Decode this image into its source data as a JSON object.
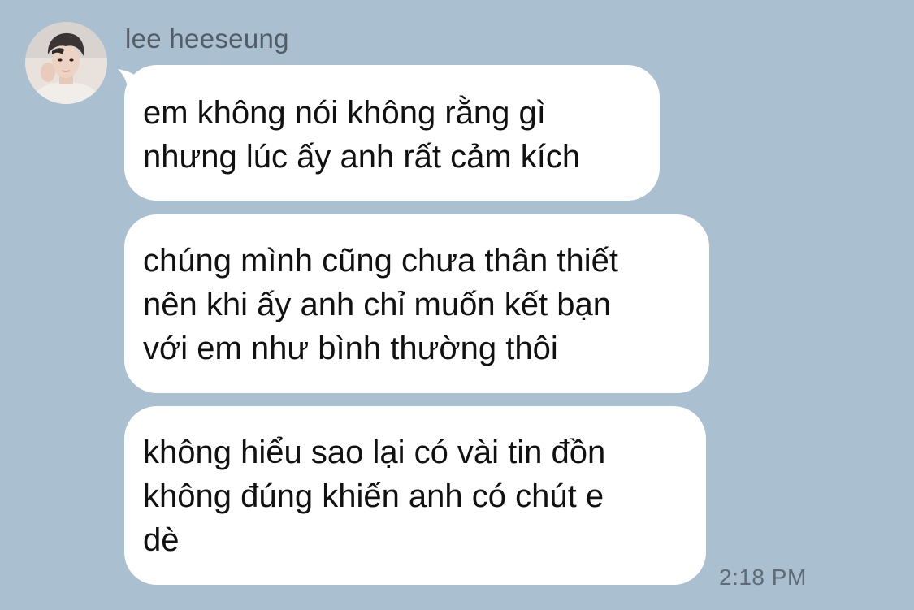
{
  "sender": {
    "name": "lee heeseung",
    "avatar_icon": "profile-photo"
  },
  "messages": [
    {
      "lines": [
        "em không nói không rằng gì",
        "nhưng lúc ấy anh rất cảm kích"
      ]
    },
    {
      "lines": [
        "chúng mình cũng chưa thân thiết",
        "nên khi ấy anh chỉ muốn kết bạn",
        "với em như bình thường thôi"
      ]
    },
    {
      "lines": [
        "không hiểu sao lại có vài tin đồn",
        "không đúng khiến anh có chút e",
        "dè"
      ]
    }
  ],
  "timestamp": "2:18 PM",
  "colors": {
    "background": "#aabfd0",
    "bubble": "#ffffff",
    "text": "#111111",
    "secondary_text": "#535d67"
  }
}
